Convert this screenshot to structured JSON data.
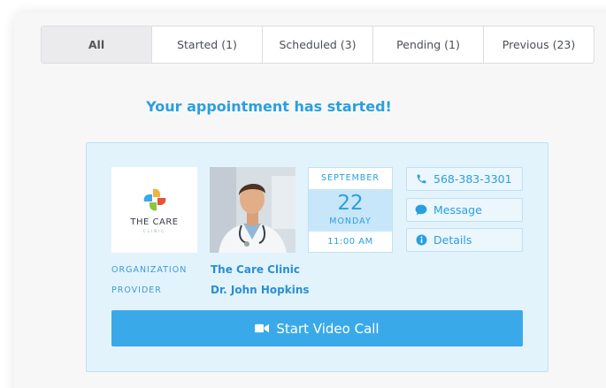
{
  "tabs": [
    {
      "label": "All"
    },
    {
      "label": "Started (1)"
    },
    {
      "label": "Scheduled (3)"
    },
    {
      "label": "Pending (1)"
    },
    {
      "label": "Previous (23)"
    }
  ],
  "headline": "Your appointment has started!",
  "appointment": {
    "logo": {
      "name": "THE CARE",
      "sub": "CLINIC"
    },
    "date": {
      "month": "SEPTEMBER",
      "day": "22",
      "weekday": "MONDAY",
      "time": "11:00 AM"
    },
    "actions": {
      "phone": "568-383-3301",
      "message": "Message",
      "details": "Details"
    },
    "organization_label": "ORGANIZATION",
    "organization": "The Care Clinic",
    "provider_label": "PROVIDER",
    "provider": "Dr. John Hopkins",
    "video_button": "Start Video Call"
  },
  "colors": {
    "accent": "#2a9fe0",
    "button": "#3aa9ea",
    "card": "#e3f3fc"
  }
}
